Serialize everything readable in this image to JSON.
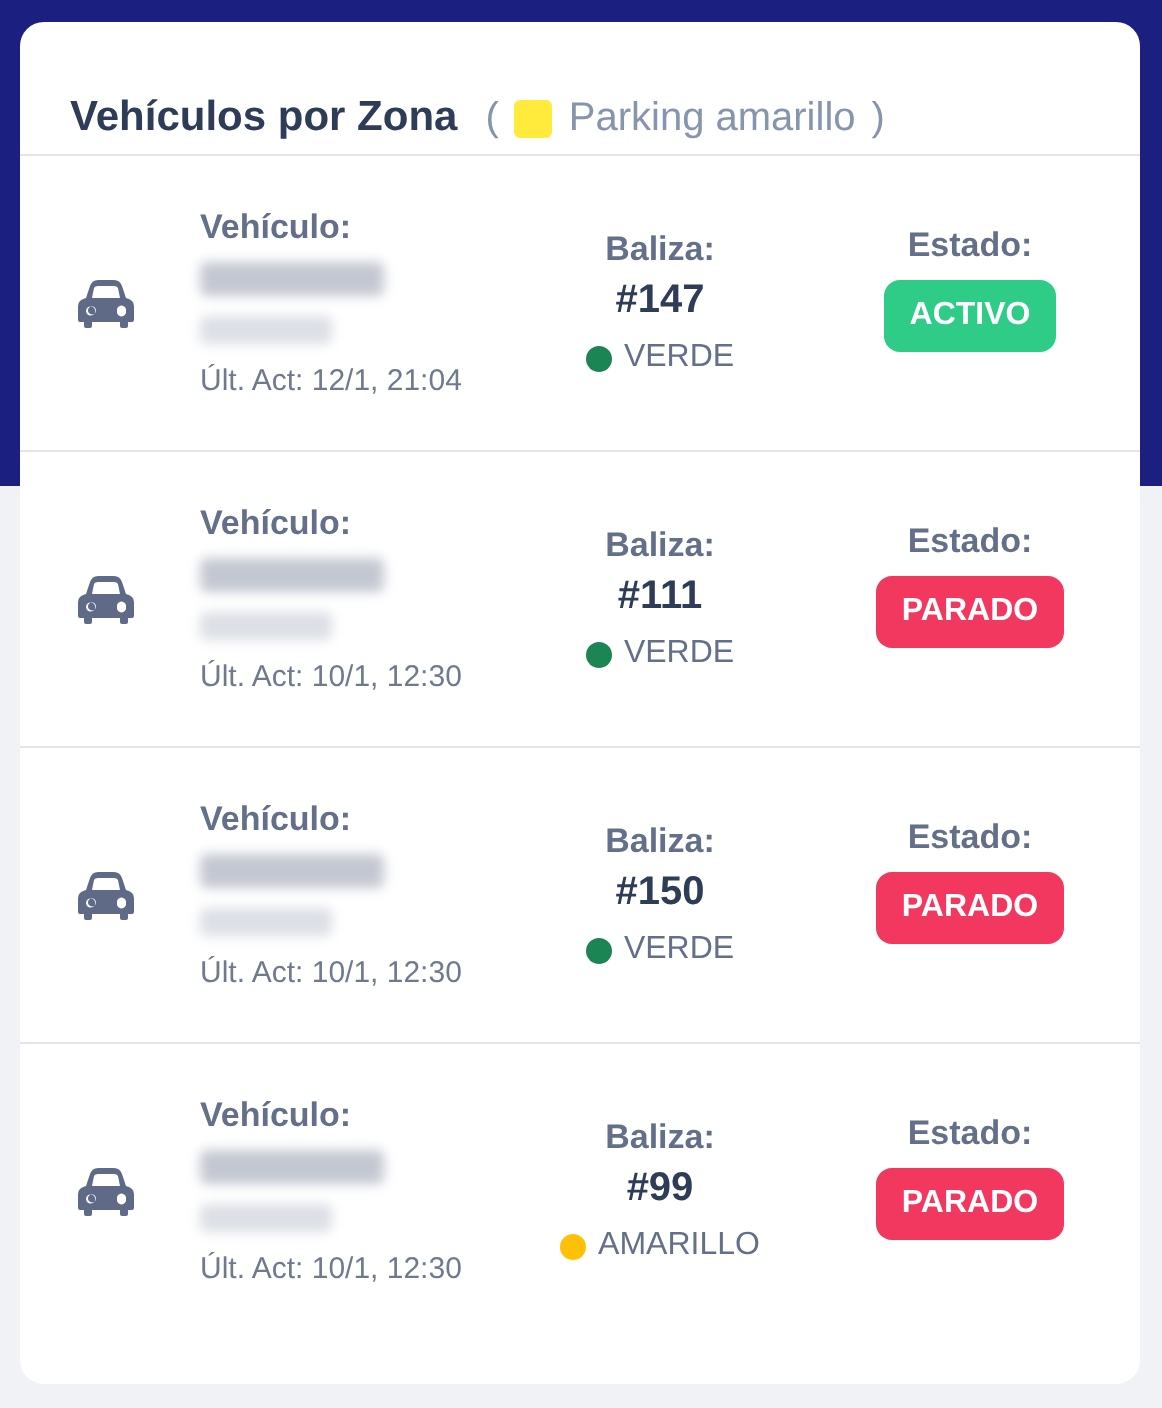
{
  "card": {
    "title": "Vehículos por Zona",
    "zone": {
      "open": "(",
      "name": "Parking amarillo",
      "close": ")",
      "color": "#ffeb3b"
    }
  },
  "vehicles": [
    {
      "vehicle_label": "Vehículo:",
      "redacted": true,
      "updated": "Últ. Act: 12/1, 21:04",
      "beacon_label": "Baliza:",
      "beacon": "#147",
      "signal": "VERDE",
      "color": "#1b8553",
      "status_label": "Estado:",
      "status": "ACTIVO",
      "kind": "active"
    },
    {
      "vehicle_label": "Vehículo:",
      "redacted": true,
      "updated": "Últ. Act: 10/1, 12:30",
      "beacon_label": "Baliza:",
      "beacon": "#111",
      "signal": "VERDE",
      "color": "#1b8553",
      "status_label": "Estado:",
      "status": "PARADO",
      "kind": "stopped"
    },
    {
      "vehicle_label": "Vehículo:",
      "redacted": true,
      "updated": "Últ. Act: 10/1, 12:30",
      "beacon_label": "Baliza:",
      "beacon": "#150",
      "signal": "VERDE",
      "color": "#1b8553",
      "status_label": "Estado:",
      "status": "PARADO",
      "kind": "stopped"
    },
    {
      "vehicle_label": "Vehículo:",
      "redacted": true,
      "updated": "Últ. Act: 10/1, 12:30",
      "beacon_label": "Baliza:",
      "beacon": "#99",
      "signal": "AMARILLO",
      "color": "#ffc107",
      "status_label": "Estado:",
      "status": "PARADO",
      "kind": "stopped"
    }
  ]
}
